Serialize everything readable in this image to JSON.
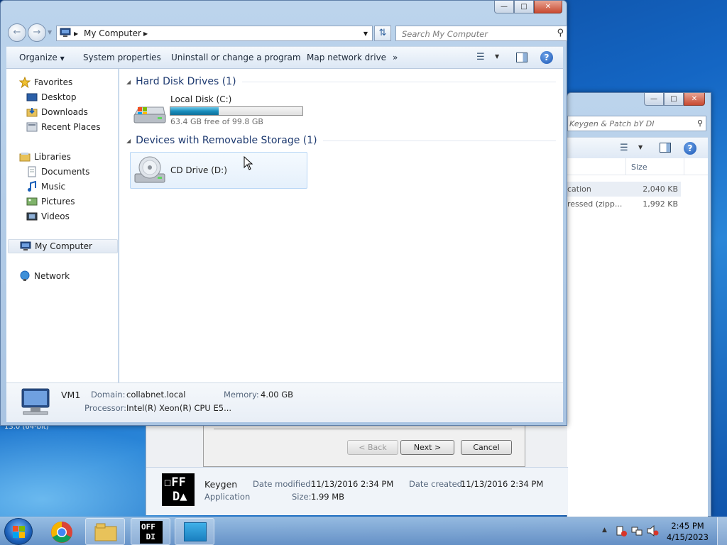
{
  "desktop": {
    "bottom_text": "13.0 (64-bit)"
  },
  "main_window": {
    "address": {
      "segments": [
        "My Computer"
      ]
    },
    "search": {
      "placeholder": "Search My Computer"
    },
    "toolbar": {
      "organize": "Organize",
      "system_properties": "System properties",
      "uninstall": "Uninstall or change a program",
      "map_network_drive": "Map network drive",
      "more": "»"
    },
    "nav": {
      "favorites": "Favorites",
      "desktop": "Desktop",
      "downloads": "Downloads",
      "recent_places": "Recent Places",
      "libraries": "Libraries",
      "documents": "Documents",
      "music": "Music",
      "pictures": "Pictures",
      "videos": "Videos",
      "my_computer": "My Computer",
      "network": "Network"
    },
    "groups": {
      "hdd": {
        "title": "Hard Disk Drives (1)",
        "drives": [
          {
            "name": "Local Disk (C:)",
            "free_text": "63.4 GB free of 99.8 GB",
            "used_fraction": 0.365
          }
        ]
      },
      "removable": {
        "title": "Devices with Removable Storage (1)",
        "drives": [
          {
            "name": "CD Drive (D:)"
          }
        ]
      }
    },
    "details": {
      "computer_name": "VM1",
      "domain_label": "Domain:",
      "domain_value": "collabnet.local",
      "memory_label": "Memory:",
      "memory_value": "4.00 GB",
      "processor_label": "Processor:",
      "processor_value": "Intel(R) Xeon(R) CPU E5..."
    }
  },
  "bg_window": {
    "search_text": "Keygen & Patch bY DI",
    "column_size": "Size",
    "rows": [
      {
        "type": "cation",
        "size": "2,040 KB"
      },
      {
        "type": "ressed (zipp...",
        "size": "1,992 KB"
      }
    ],
    "wizard": {
      "back": "< Back",
      "next": "Next >",
      "cancel": "Cancel"
    },
    "details": {
      "name": "Keygen",
      "type": "Application",
      "modified_label": "Date modified:",
      "modified_value": "11/13/2016 2:34 PM",
      "created_label": "Date created:",
      "created_value": "11/13/2016 2:34 PM",
      "size_label": "Size:",
      "size_value": "1.99 MB"
    },
    "icon_text": "ᴏꜰꜰ DI"
  },
  "taskbar": {
    "time": "2:45 PM",
    "date": "4/15/2023"
  }
}
